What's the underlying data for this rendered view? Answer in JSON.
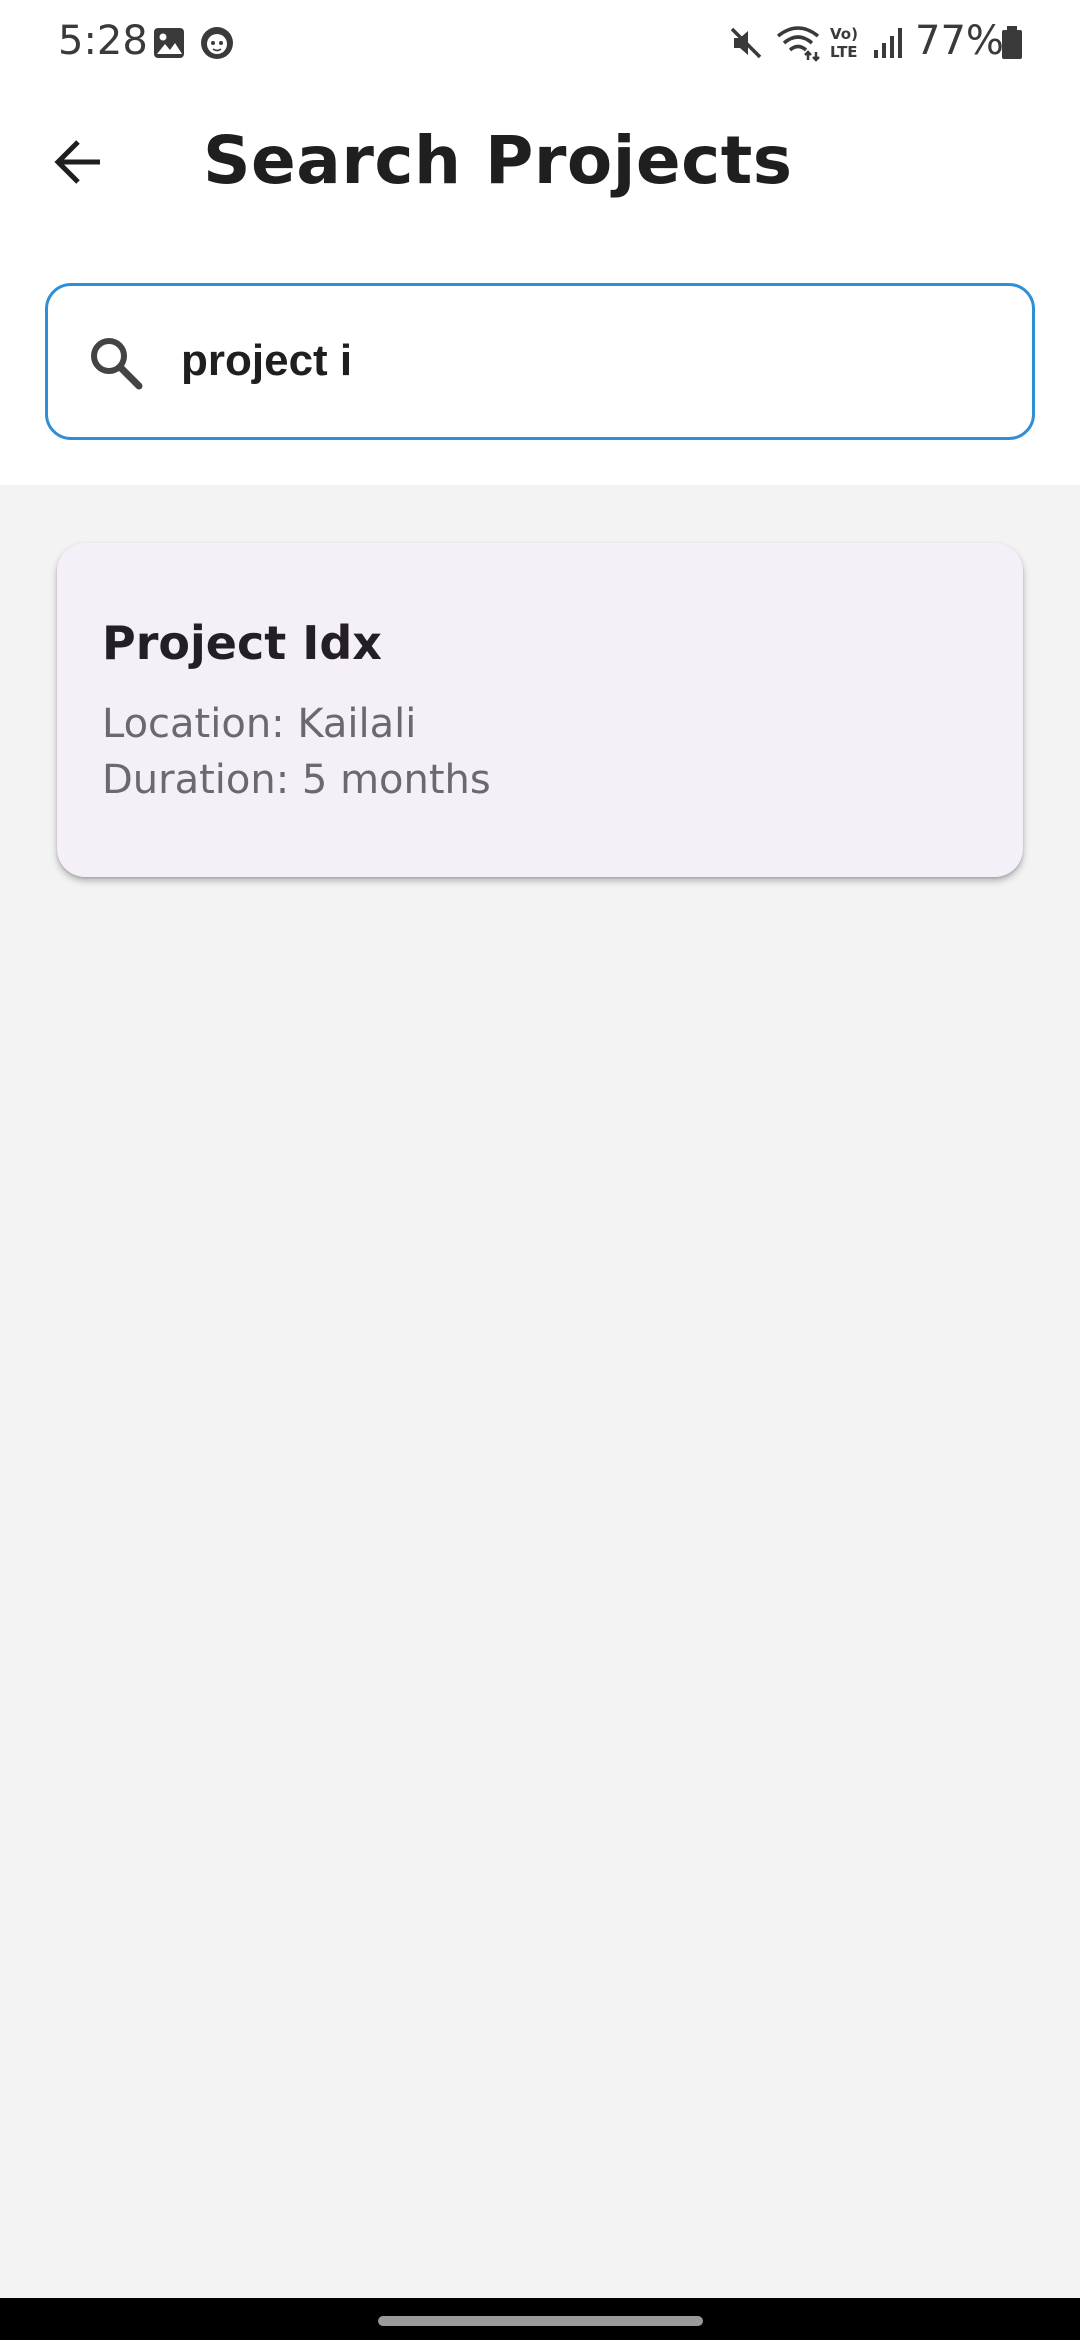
{
  "status_bar": {
    "time": "5:28",
    "battery": "77%",
    "icons": [
      "gallery-icon",
      "face-app-icon",
      "mute-icon",
      "wifi-icon",
      "volte-icon",
      "signal-icon",
      "battery-icon"
    ]
  },
  "app_bar": {
    "title": "Search Projects",
    "back_icon": "arrow-back-icon"
  },
  "search": {
    "value": "project i",
    "placeholder": "",
    "accent_color": "#2f8fd6"
  },
  "results": [
    {
      "title": "Project Idx",
      "location": "Location: Kailali",
      "duration": "Duration: 5 months"
    }
  ],
  "colors": {
    "card_background": "#f5eff7",
    "page_background": "#f3f3f3"
  }
}
